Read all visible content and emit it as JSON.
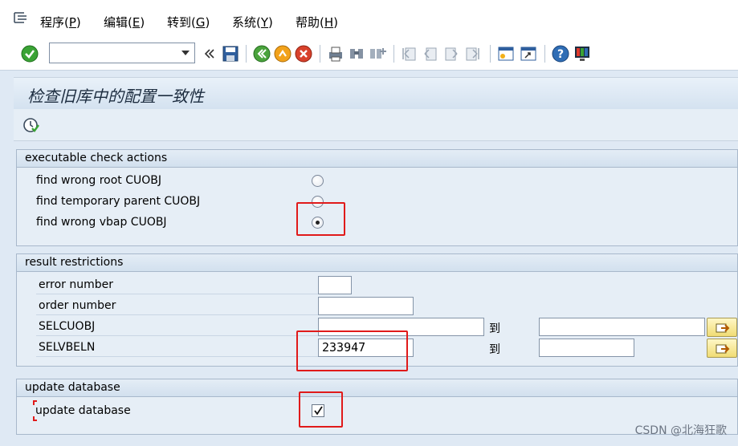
{
  "menu": {
    "items": [
      {
        "label": "程序",
        "hotkey": "P"
      },
      {
        "label": "编辑",
        "hotkey": "E"
      },
      {
        "label": "转到",
        "hotkey": "G"
      },
      {
        "label": "系统",
        "hotkey": "Y"
      },
      {
        "label": "帮助",
        "hotkey": "H"
      }
    ]
  },
  "toolbar": {
    "command_value": ""
  },
  "page": {
    "title": "检查旧库中的配置一致性"
  },
  "groups": {
    "actions": {
      "title": "executable check actions",
      "options": [
        {
          "label": "find wrong root CUOBJ",
          "selected": false
        },
        {
          "label": "find temporary parent CUOBJ",
          "selected": false
        },
        {
          "label": "find wrong vbap CUOBJ",
          "selected": true
        }
      ]
    },
    "restrictions": {
      "title": "result restrictions",
      "to_label": "到",
      "fields": {
        "error_number": {
          "label": "error number",
          "value": ""
        },
        "order_number": {
          "label": "order number",
          "value": ""
        },
        "selcuobj": {
          "label": "SELCUOBJ",
          "low": "",
          "high": ""
        },
        "selvbeln": {
          "label": "SELVBELN",
          "low": "233947",
          "high": ""
        }
      }
    },
    "update": {
      "title": "update database",
      "checkbox_label": "update database",
      "checked": true
    }
  },
  "watermark": "CSDN @北海狂歌"
}
